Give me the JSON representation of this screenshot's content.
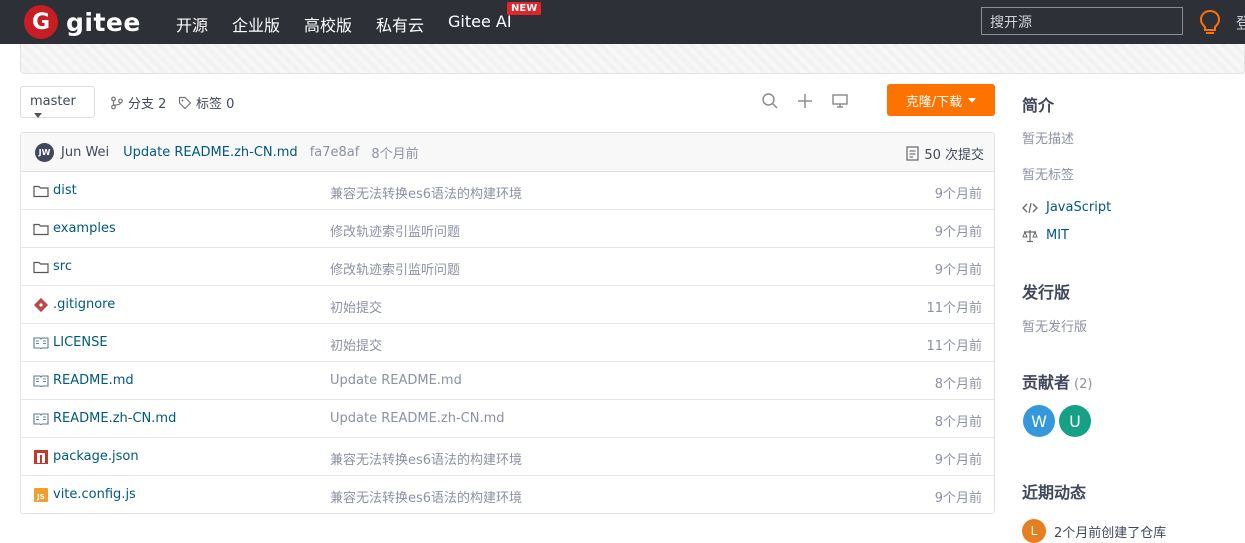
{
  "nav": {
    "logo_letter": "G",
    "logo_text": "gitee",
    "items": [
      "开源",
      "企业版",
      "高校版",
      "私有云",
      "Gitee AI"
    ],
    "new_badge": "NEW",
    "search_placeholder": "搜开源",
    "edge_text": "登"
  },
  "toolbar": {
    "branch": "master",
    "branches_label": "分支 2",
    "tags_label": "标签 0",
    "clone_label": "克隆/下载"
  },
  "commit": {
    "avatar_initials": "JW",
    "author": "Jun Wei",
    "message": "Update README.zh-CN.md",
    "hash": "fa7e8af",
    "time": "8个月前",
    "count_label": "50 次提交"
  },
  "files": [
    {
      "name": "dist",
      "type": "folder",
      "commit": "兼容无法转换es6语法的构建环境",
      "time": "9个月前"
    },
    {
      "name": "examples",
      "type": "folder",
      "commit": "修改轨迹索引监听问题",
      "time": "9个月前"
    },
    {
      "name": "src",
      "type": "folder",
      "commit": "修改轨迹索引监听问题",
      "time": "9个月前"
    },
    {
      "name": ".gitignore",
      "type": "git",
      "commit": "初始提交",
      "time": "11个月前"
    },
    {
      "name": "LICENSE",
      "type": "doc",
      "commit": "初始提交",
      "time": "11个月前"
    },
    {
      "name": "README.md",
      "type": "doc",
      "commit": "Update README.md",
      "time": "8个月前"
    },
    {
      "name": "README.zh-CN.md",
      "type": "doc",
      "commit": "Update README.zh-CN.md",
      "time": "8个月前"
    },
    {
      "name": "package.json",
      "type": "npm",
      "commit": "兼容无法转换es6语法的构建环境",
      "time": "9个月前"
    },
    {
      "name": "vite.config.js",
      "type": "js",
      "commit": "兼容无法转换es6语法的构建环境",
      "time": "9个月前"
    }
  ],
  "sidebar": {
    "intro_title": "简介",
    "no_desc": "暂无描述",
    "no_tags": "暂无标签",
    "language": "JavaScript",
    "license": "MIT",
    "release_title": "发行版",
    "no_release": "暂无发行版",
    "contrib_title": "贡献者",
    "contrib_count": "(2)",
    "contributors": [
      {
        "initial": "W",
        "color": "#3498db"
      },
      {
        "initial": "U",
        "color": "#16a085"
      }
    ],
    "activity_title": "近期动态",
    "activity_avatar": "L",
    "activity_text": "2个月前创建了仓库"
  },
  "colors": {
    "accent": "#fe7300",
    "link": "#005980",
    "nav_bg": "#2e3038"
  }
}
